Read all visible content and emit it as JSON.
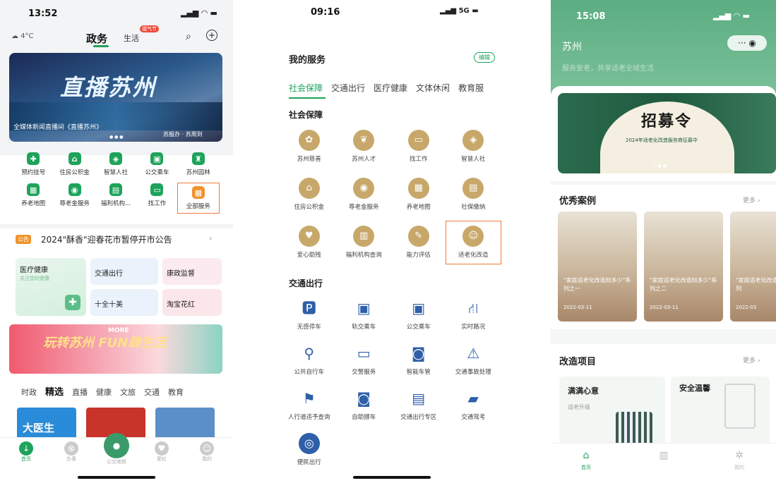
{
  "p1": {
    "time": "13:52",
    "temp": "4°C",
    "nav_tabs": [
      "政务",
      "生活"
    ],
    "badge": "福气节",
    "banner_title": "直播苏州",
    "banner_caption": "全媒体新闻直播间《直播苏州》",
    "banner_source": "苏报办 · 苏周到",
    "grid": [
      {
        "label": "预约挂号",
        "icon": "plus-icon",
        "color": "#1ea35a"
      },
      {
        "label": "住房公积金",
        "icon": "house-icon",
        "color": "#1ea35a"
      },
      {
        "label": "智慧人社",
        "icon": "shield-icon",
        "color": "#1ea35a"
      },
      {
        "label": "公交乘车",
        "icon": "bus-icon",
        "color": "#1ea35a"
      },
      {
        "label": "苏州园林",
        "icon": "pagoda-icon",
        "color": "#1ea35a"
      },
      {
        "label": "养老地图",
        "icon": "map-icon",
        "color": "#1ea35a"
      },
      {
        "label": "尊老金服务",
        "icon": "coin-icon",
        "color": "#1ea35a"
      },
      {
        "label": "福利机构...",
        "icon": "building-icon",
        "color": "#1ea35a"
      },
      {
        "label": "找工作",
        "icon": "briefcase-icon",
        "color": "#1ea35a"
      },
      {
        "label": "全部服务",
        "icon": "grid-icon",
        "color": "#f0922b"
      }
    ],
    "notice": "2024\"酥香\"迎春花市暂停开市公告",
    "cards": [
      {
        "title": "医疗健康",
        "sub": "关注您的健康"
      },
      {
        "title": "交通出行",
        "sub": ""
      },
      {
        "title": "康政监督",
        "sub": ""
      },
      {
        "title": "十全十美",
        "sub": ""
      },
      {
        "title": "淘宝花红",
        "sub": ""
      }
    ],
    "promo": "玩转苏州 FUN肆生活",
    "promo_tag": "MORE",
    "bottom_tabs": [
      "时政",
      "精选",
      "直播",
      "健康",
      "文旅",
      "交通",
      "教育"
    ],
    "thumb_text": "大医生",
    "tabbar": [
      "首页",
      "办事",
      "公交地铁",
      "爱红",
      "我的"
    ]
  },
  "p2": {
    "time": "09:16",
    "network": "5G",
    "header": "我的服务",
    "edit": "编辑",
    "tabs": [
      "社会保障",
      "交通出行",
      "医疗健康",
      "文体休闲",
      "教育服"
    ],
    "section1": "社会保障",
    "social": [
      {
        "label": "苏州慈善",
        "icon": "charity-icon"
      },
      {
        "label": "苏州人才",
        "icon": "talent-icon"
      },
      {
        "label": "找工作",
        "icon": "briefcase-icon"
      },
      {
        "label": "智慧人社",
        "icon": "shield-icon"
      },
      {
        "label": "住房公积金",
        "icon": "house-icon"
      },
      {
        "label": "尊老金服务",
        "icon": "coin-icon"
      },
      {
        "label": "养老地图",
        "icon": "map-icon"
      },
      {
        "label": "社保缴纳",
        "icon": "card-icon"
      },
      {
        "label": "爱心助残",
        "icon": "heart-icon"
      },
      {
        "label": "福利机构查询",
        "icon": "building-icon"
      },
      {
        "label": "能力评估",
        "icon": "doc-icon"
      },
      {
        "label": "适老化改造",
        "icon": "elder-icon"
      }
    ],
    "section2": "交通出行",
    "transport": [
      {
        "label": "无感停车",
        "icon": "parking-icon"
      },
      {
        "label": "轨交乘车",
        "icon": "metro-icon"
      },
      {
        "label": "公交乘车",
        "icon": "bus-icon"
      },
      {
        "label": "实时路况",
        "icon": "road-icon"
      },
      {
        "label": "公共自行车",
        "icon": "bike-icon"
      },
      {
        "label": "交警服务",
        "icon": "police-icon"
      },
      {
        "label": "智能车管",
        "icon": "car-icon"
      },
      {
        "label": "交通事故处理",
        "icon": "accident-icon"
      },
      {
        "label": "人行道违予查询",
        "icon": "pedestrian-icon"
      },
      {
        "label": "自助挪车",
        "icon": "car2-icon"
      },
      {
        "label": "交通出行专区",
        "icon": "traffic-icon"
      },
      {
        "label": "交通驾考",
        "icon": "truck-icon"
      },
      {
        "label": "便民出行",
        "icon": "compass-icon"
      }
    ]
  },
  "p3": {
    "time": "15:08",
    "city": "苏州",
    "slogan": "服务安老，共享适老全域生活",
    "banner_title": "招募令",
    "banner_sub": "2024年适老化改造服务商征募中",
    "cases_title": "优秀案例",
    "more": "更多",
    "cases": [
      {
        "caption": "\"家庭适老化改造知多少\"系列之一",
        "date": "2022-03-11"
      },
      {
        "caption": "\"家庭适老化改造知多少\"系列之二",
        "date": "2022-03-11"
      },
      {
        "caption": "\"家庭适老化改造知多少\"系列",
        "date": "2022-03"
      }
    ],
    "projects_title": "改造项目",
    "projects": [
      {
        "title": "满满心意",
        "sub": "适老升级"
      },
      {
        "title": "安全温馨",
        "sub": ""
      }
    ],
    "tabbar": [
      "首页",
      "",
      "我的"
    ]
  }
}
